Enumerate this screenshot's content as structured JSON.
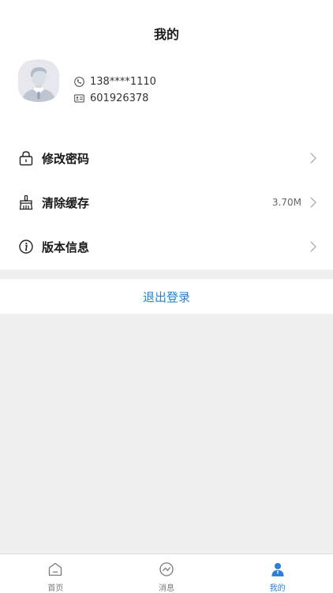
{
  "header": {
    "title": "我的"
  },
  "profile": {
    "phone": "138****1110",
    "id_number": "601926378",
    "phone_icon": "phone-icon",
    "id_icon": "id-card-icon",
    "avatar_icon": "user-avatar"
  },
  "menu": {
    "items": [
      {
        "label": "修改密码",
        "value": "",
        "icon": "lock-icon"
      },
      {
        "label": "清除缓存",
        "value": "3.70M",
        "icon": "broom-icon"
      },
      {
        "label": "版本信息",
        "value": "",
        "icon": "info-icon"
      }
    ]
  },
  "logout": {
    "label": "退出登录"
  },
  "tabbar": {
    "items": [
      {
        "label": "首页",
        "icon": "home-icon",
        "active": false
      },
      {
        "label": "消息",
        "icon": "message-icon",
        "active": false
      },
      {
        "label": "我的",
        "icon": "profile-icon",
        "active": true
      }
    ]
  },
  "colors": {
    "accent": "#2b7fd6",
    "background": "#f0f0f0",
    "text": "#1a1a1a"
  }
}
